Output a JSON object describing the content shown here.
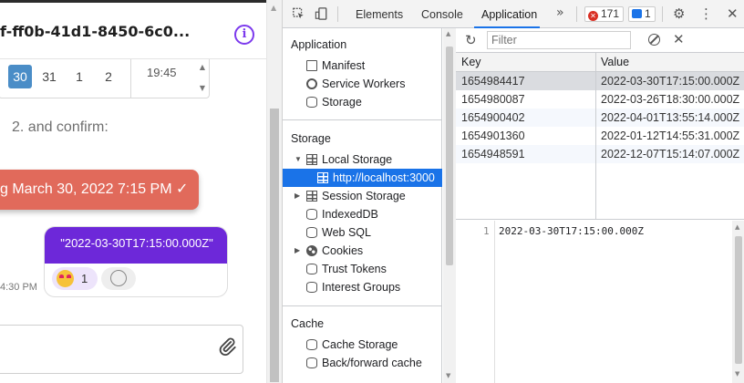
{
  "chat": {
    "title": "f-ff0b-41d1-8450-6c0...",
    "info_icon": "i",
    "picker": {
      "days": [
        "30",
        "31",
        "1",
        "2"
      ],
      "selected_day": "30",
      "time": "19:45"
    },
    "instruction": "2. and confirm:",
    "confirm_text": "g March 30, 2022 7:15 PM ✓",
    "message_text": "\"2022-03-30T17:15:00.000Z\"",
    "reaction_count": "1",
    "message_time": "4:30 PM",
    "icons": {
      "info": "info-icon",
      "reaction_emoji": "heart-eyes-emoji",
      "add_reaction": "add-reaction-icon",
      "attach": "paperclip-icon"
    }
  },
  "devtools": {
    "tabs": [
      "Elements",
      "Console",
      "Application"
    ],
    "active_tab": "Application",
    "more_tabs": "»",
    "error_count": "171",
    "message_count": "1",
    "sidebar": {
      "application_header": "Application",
      "application_items": [
        "Manifest",
        "Service Workers",
        "Storage"
      ],
      "storage_header": "Storage",
      "storage_items": {
        "local_storage": "Local Storage",
        "localhost": "http://localhost:3000",
        "session_storage": "Session Storage",
        "indexeddb": "IndexedDB",
        "websql": "Web SQL",
        "cookies": "Cookies",
        "trust_tokens": "Trust Tokens",
        "interest_groups": "Interest Groups"
      },
      "cache_header": "Cache",
      "cache_items": [
        "Cache Storage",
        "Back/forward cache"
      ]
    },
    "filter_placeholder": "Filter",
    "table": {
      "headers": [
        "Key",
        "Value"
      ],
      "rows": [
        {
          "key": "1654984417",
          "value": "2022-03-30T17:15:00.000Z"
        },
        {
          "key": "1654980087",
          "value": "2022-03-26T18:30:00.000Z"
        },
        {
          "key": "1654900402",
          "value": "2022-04-01T13:55:14.000Z"
        },
        {
          "key": "1654901360",
          "value": "2022-01-12T14:55:31.000Z"
        },
        {
          "key": "1654948591",
          "value": "2022-12-07T15:14:07.000Z"
        }
      ],
      "selected_row": 0
    },
    "preview": {
      "line_number": "1",
      "content": "2022-03-30T17:15:00.000Z"
    },
    "colors": {
      "accent": "#1a73e8",
      "confirm": "#e16a5b",
      "message": "#6d28d9"
    }
  }
}
